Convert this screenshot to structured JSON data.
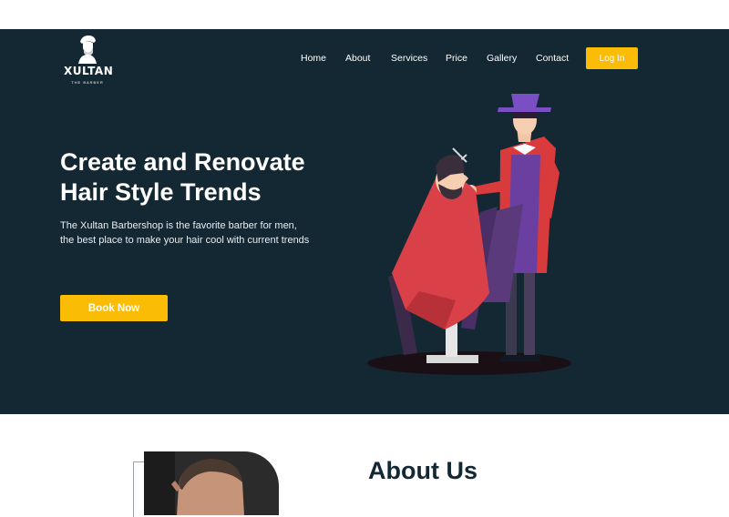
{
  "brand": {
    "name": "XULTAN",
    "tagline": "THE BARBER"
  },
  "nav": {
    "items": [
      {
        "label": "Home"
      },
      {
        "label": "About"
      },
      {
        "label": "Services"
      },
      {
        "label": "Price"
      },
      {
        "label": "Gallery"
      },
      {
        "label": "Contact"
      }
    ],
    "login_label": "Log In"
  },
  "hero": {
    "title_line1": "Create and Renovate",
    "title_line2": "Hair Style Trends",
    "desc_line1": "The Xultan Barbershop is the favorite barber for men,",
    "desc_line2": "the best place to make your hair cool with current trends",
    "cta_label": "Book Now"
  },
  "about": {
    "title": "About Us"
  },
  "colors": {
    "hero_bg": "#142833",
    "accent": "#fbbc05",
    "heading_dark": "#142833"
  }
}
